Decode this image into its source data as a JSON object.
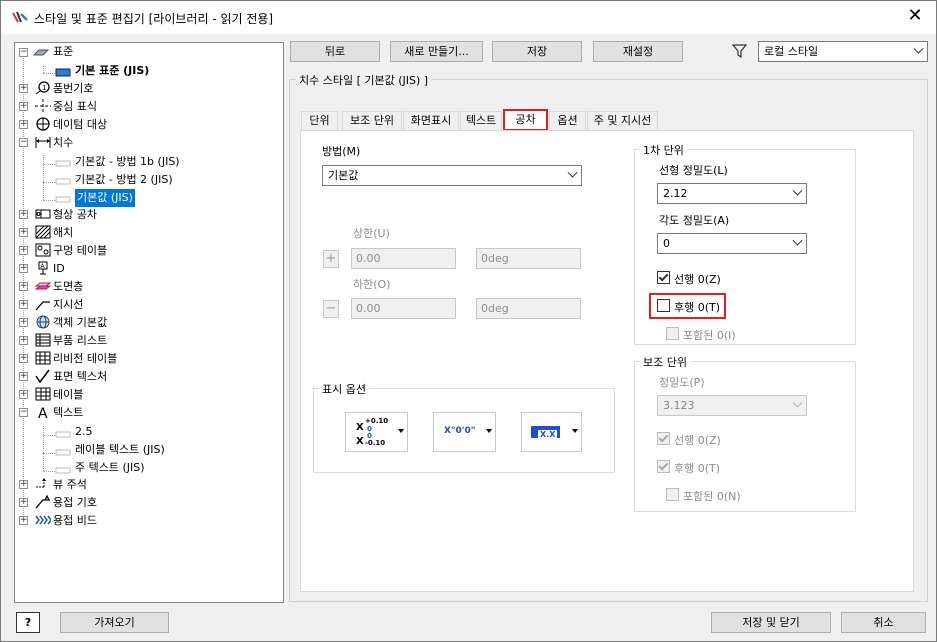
{
  "window": {
    "title": "스타일 및 표준 편집기 [라이브러리 - 읽기 전용]"
  },
  "tree": {
    "items": [
      {
        "label": "표준"
      },
      {
        "label": "기본 표준 (JIS)"
      },
      {
        "label": "품번기호"
      },
      {
        "label": "중심 표식"
      },
      {
        "label": "데이텀 대상"
      },
      {
        "label": "치수"
      },
      {
        "label": "기본값 - 방법 1b (JIS)"
      },
      {
        "label": "기본값 - 방법 2 (JIS)"
      },
      {
        "label": "기본값 (JIS)"
      },
      {
        "label": "형상 공차"
      },
      {
        "label": "해치"
      },
      {
        "label": "구멍 테이블"
      },
      {
        "label": "ID"
      },
      {
        "label": "도면층"
      },
      {
        "label": "지시선"
      },
      {
        "label": "객체 기본값"
      },
      {
        "label": "부품 리스트"
      },
      {
        "label": "리비전 테이블"
      },
      {
        "label": "표면 텍스처"
      },
      {
        "label": "테이블"
      },
      {
        "label": "텍스트"
      },
      {
        "label": "2.5"
      },
      {
        "label": "레이블 텍스트 (JIS)"
      },
      {
        "label": "주 텍스트 (JIS)"
      },
      {
        "label": "뷰 주석"
      },
      {
        "label": "용접 기호"
      },
      {
        "label": "용접 비드"
      }
    ]
  },
  "toolbar": {
    "back": "뒤로",
    "new": "새로 만들기...",
    "save": "저장",
    "reset": "재설정",
    "filter_value": "로컬 스타일"
  },
  "panel": {
    "title": "치수 스타일 [ 기본값 (JIS) ]",
    "tabs": [
      "단위",
      "보조 단위",
      "화면표시",
      "텍스트",
      "공차",
      "옵션",
      "주 및 지시선"
    ],
    "method_label": "방법(M)",
    "method_value": "기본값",
    "upper_label": "상한(U)",
    "lower_label": "하한(O)",
    "upper_value": "0.00",
    "upper_deg": "0deg",
    "lower_value": "0.00",
    "lower_deg": "0deg",
    "plus": "+",
    "minus": "−",
    "display_options": "표시 옵션",
    "opt1_top": "+0.10",
    "opt1_mid": "0",
    "opt1_bot": "-0.10",
    "opt1_x": "X",
    "opt2": "X°0'0\"",
    "opt3": "X.X",
    "primary": {
      "title": "1차 단위",
      "linear_precision_label": "선형 정밀도(L)",
      "linear_precision": "2.12",
      "angular_precision_label": "각도 정밀도(A)",
      "angular_precision": "0",
      "leading_zero": "선행 0(Z)",
      "trailing_zero": "후행 0(T)",
      "included_zero": "포함된 0(I)"
    },
    "alternate": {
      "title": "보조 단위",
      "precision_label": "정밀도(P)",
      "precision": "3.123",
      "leading_zero": "선행 0(Z)",
      "trailing_zero": "후행 0(T)",
      "included_zero": "포함된 0(N)"
    }
  },
  "footer": {
    "help": "?",
    "import": "가져오기",
    "save_close": "저장 및 닫기",
    "cancel": "취소"
  }
}
